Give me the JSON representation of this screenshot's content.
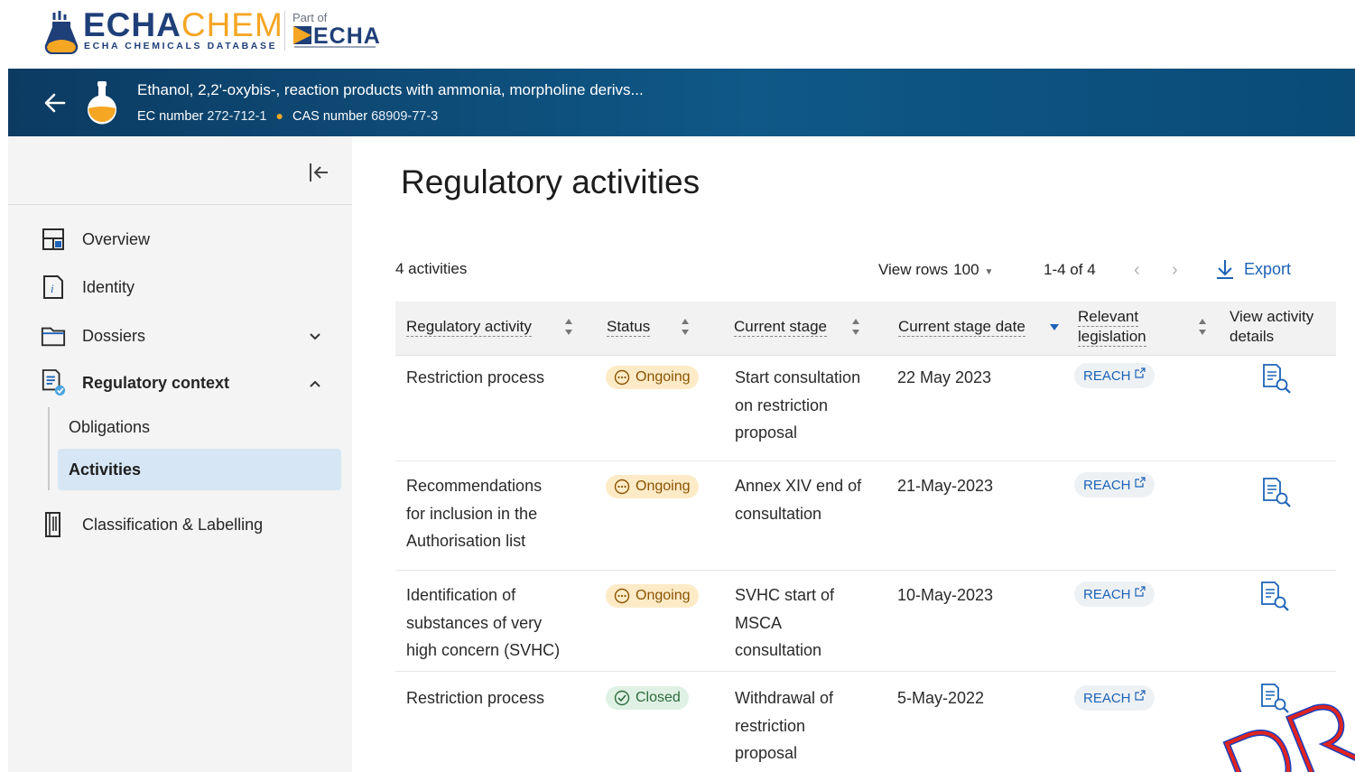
{
  "brand": {
    "name_part1": "ECHA",
    "name_part2": "CHEM",
    "tagline": "ECHA CHEMICALS DATABASE",
    "part_of": "Part of",
    "parent": "ECHA"
  },
  "substance": {
    "name": "Ethanol, 2,2'-oxybis-, reaction products with ammonia, morpholine derivs...",
    "ec_label": "EC number",
    "ec_value": "272-712-1",
    "cas_label": "CAS number",
    "cas_value": "68909-77-3"
  },
  "sidebar": {
    "items": [
      {
        "label": "Overview",
        "icon": "overview-icon"
      },
      {
        "label": "Identity",
        "icon": "identity-icon"
      },
      {
        "label": "Dossiers",
        "icon": "folder-icon",
        "expanded": false
      },
      {
        "label": "Regulatory context",
        "icon": "regulatory-icon",
        "expanded": true
      },
      {
        "label": "Classification & Labelling",
        "icon": "book-icon"
      }
    ],
    "subitems": [
      {
        "label": "Obligations",
        "active": false
      },
      {
        "label": "Activities",
        "active": true
      }
    ]
  },
  "main": {
    "title": "Regulatory activities",
    "count_text": "4 activities",
    "view_rows_label": "View rows",
    "view_rows_value": "100",
    "range_text": "1-4 of 4",
    "export_label": "Export"
  },
  "table": {
    "headers": {
      "activity": "Regulatory activity",
      "status": "Status",
      "stage": "Current stage",
      "date": "Current stage date",
      "legislation_1": "Relevant",
      "legislation_2": "legislation",
      "details_1": "View activity",
      "details_2": "details"
    },
    "rows": [
      {
        "activity": [
          "Restriction process"
        ],
        "status": "Ongoing",
        "stage": [
          "Start consultation",
          "on restriction",
          "proposal"
        ],
        "date": "22 May 2023",
        "legislation": "REACH"
      },
      {
        "activity": [
          "Recommendations",
          "for inclusion in the",
          "Authorisation list"
        ],
        "status": "Ongoing",
        "stage": [
          "Annex XIV end of",
          "consultation"
        ],
        "date": "21-May-2023",
        "legislation": "REACH"
      },
      {
        "activity": [
          "Identification of",
          "substances of very",
          "high concern (SVHC)"
        ],
        "status": "Ongoing",
        "stage": [
          "SVHC start of",
          "MSCA",
          "consultation"
        ],
        "date": "10-May-2023",
        "legislation": "REACH"
      },
      {
        "activity": [
          "Restriction process"
        ],
        "status": "Closed",
        "stage": [
          "Withdrawal of",
          "restriction",
          "proposal"
        ],
        "date": "5-May-2022",
        "legislation": "REACH"
      }
    ]
  },
  "colors": {
    "header_bg": "#0f4f7d",
    "accent_orange": "#f5a623",
    "link_blue": "#1c63b7",
    "active_nav": "#d6e6f4",
    "ongoing_bg": "#fdebc8",
    "closed_bg": "#dff1e4"
  }
}
